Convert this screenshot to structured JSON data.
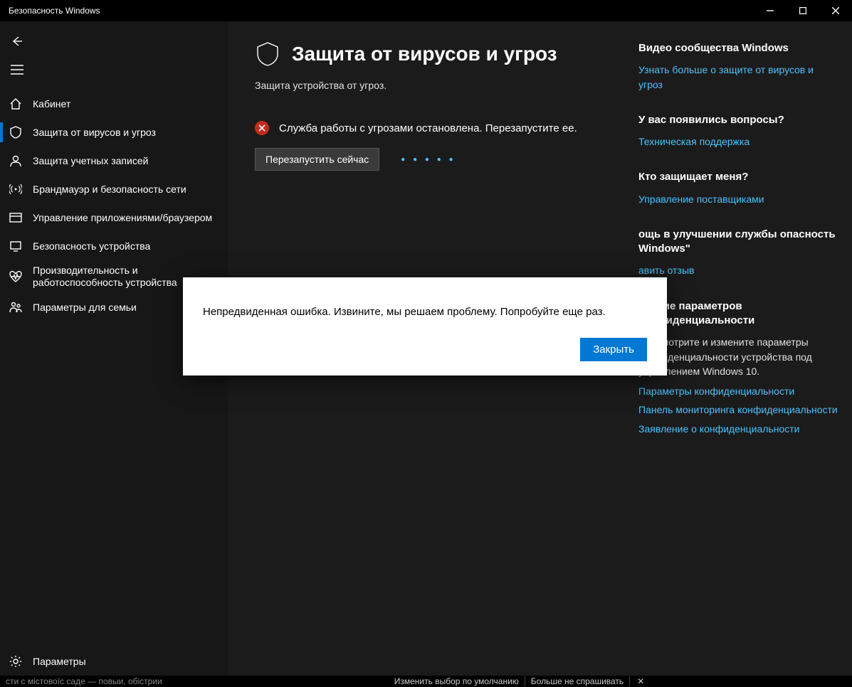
{
  "window": {
    "title": "Безопасность Windows"
  },
  "sidebar": {
    "items": [
      {
        "label": "Кабинет"
      },
      {
        "label": "Защита от вирусов и угроз"
      },
      {
        "label": "Защита учетных записей"
      },
      {
        "label": "Брандмауэр и безопасность сети"
      },
      {
        "label": "Управление приложениями/браузером"
      },
      {
        "label": "Безопасность устройства"
      },
      {
        "label": "Производительность и работоспособность устройства"
      },
      {
        "label": "Параметры для семьи"
      }
    ],
    "footer": {
      "label": "Параметры"
    }
  },
  "page": {
    "title": "Защита от вирусов и угроз",
    "subtitle": "Защита устройства от угроз.",
    "status": "Служба работы с угрозами остановлена. Перезапустите ее.",
    "restart_label": "Перезапустить сейчас"
  },
  "dialog": {
    "message": "Непредвиденная ошибка. Извините, мы решаем проблему. Попробуйте еще раз.",
    "close_label": "Закрыть"
  },
  "right": {
    "s1": {
      "title": "Видео сообщества Windows",
      "link": "Узнать больше о защите от вирусов и угроз"
    },
    "s2": {
      "title": "У вас появились вопросы?",
      "link": "Техническая поддержка"
    },
    "s3": {
      "title": "Кто защищает меня?",
      "link": "Управление поставщиками"
    },
    "s4": {
      "title_frag": "ощь в улучшении службы опасность Windows\"",
      "link_frag": "авить отзыв"
    },
    "s5": {
      "title_frag": "енение параметров конфиденциальности",
      "body": "Просмотрите и измените параметры конфиденциальности устройства под управлением Windows 10.",
      "link1": "Параметры конфиденциальности",
      "link2": "Панель мониторинга конфиденциальности",
      "link3": "Заявление о конфиденциальности"
    }
  },
  "bottombar": {
    "frag1": "сти с містовоїс саде — повыи, обістрии",
    "btn1": "Изменить выбор по умолчанию",
    "btn2": "Больше не спрашивать"
  }
}
